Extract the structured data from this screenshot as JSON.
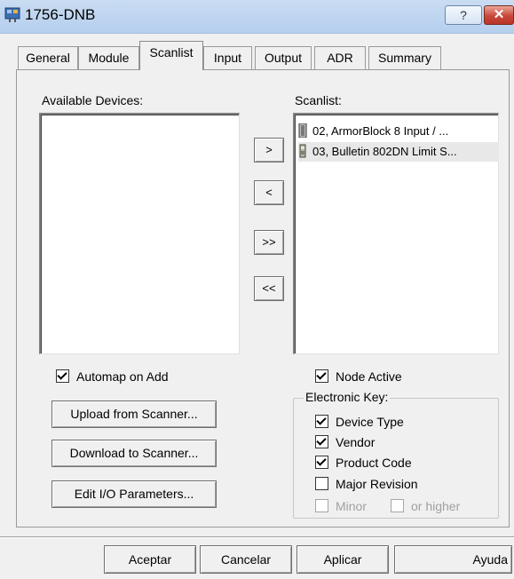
{
  "window": {
    "title": "1756-DNB",
    "help_label": "?",
    "close_label": "✕"
  },
  "tabs": [
    {
      "label": "General"
    },
    {
      "label": "Module"
    },
    {
      "label": "Scanlist"
    },
    {
      "label": "Input"
    },
    {
      "label": "Output"
    },
    {
      "label": "ADR"
    },
    {
      "label": "Summary"
    }
  ],
  "selected_tab": "Scanlist",
  "available": {
    "label": "Available Devices:",
    "items": []
  },
  "scanlist": {
    "label": "Scanlist:",
    "items": [
      {
        "label": "02, ArmorBlock 8 Input / ...",
        "icon": "armorblock-device-icon"
      },
      {
        "label": "03, Bulletin 802DN Limit S...",
        "icon": "limit-switch-device-icon"
      }
    ]
  },
  "transfer_buttons": {
    "add": ">",
    "remove": "<",
    "add_all": ">>",
    "remove_all": "<<"
  },
  "automap": {
    "label": "Automap on Add",
    "checked": true
  },
  "buttons": {
    "upload": "Upload from Scanner...",
    "download": "Download to Scanner...",
    "edit_io": "Edit I/O Parameters..."
  },
  "node_active": {
    "label": "Node Active",
    "checked": true
  },
  "electronic_key": {
    "title": "Electronic Key:",
    "device_type": {
      "label": "Device Type",
      "checked": true
    },
    "vendor": {
      "label": "Vendor",
      "checked": true
    },
    "product_code": {
      "label": "Product Code",
      "checked": true
    },
    "major_revision": {
      "label": "Major Revision",
      "checked": false
    },
    "minor": {
      "label": "Minor",
      "checked": false,
      "disabled": true
    },
    "or_higher": {
      "label": "or higher",
      "checked": false,
      "disabled": true
    }
  },
  "dialog_buttons": {
    "ok": "Aceptar",
    "cancel": "Cancelar",
    "apply": "Aplicar",
    "help": "Ayuda"
  }
}
